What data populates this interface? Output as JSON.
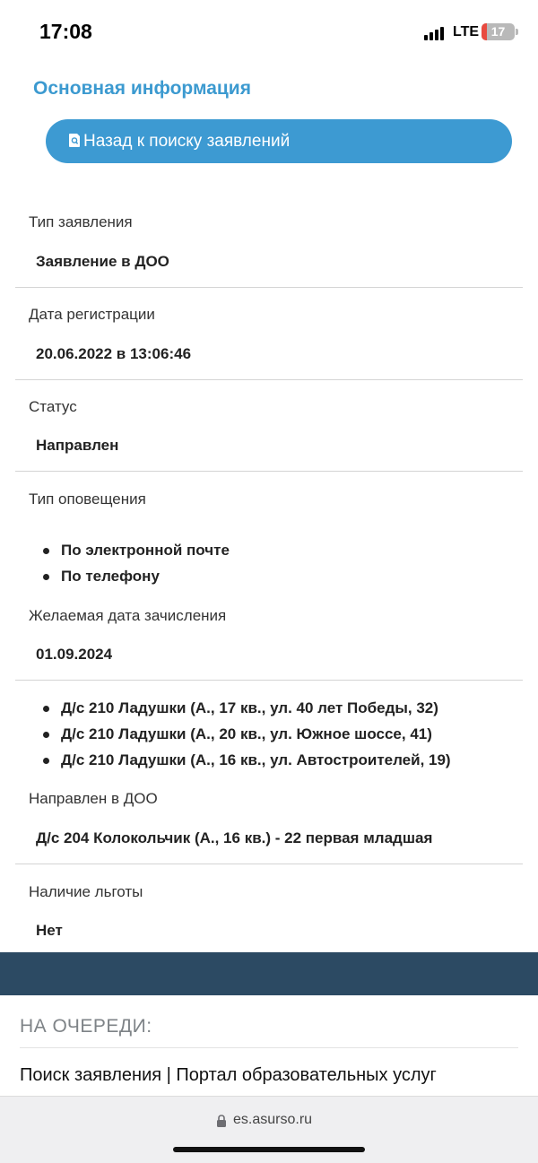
{
  "status_bar": {
    "time": "17:08",
    "network": "LTE",
    "battery": "17",
    "battery_level": 0.17
  },
  "header": {
    "title": "Основная информация",
    "back_button": "Назад к поиску заявлений",
    "back_icon": "search-document-icon"
  },
  "fields": {
    "type": {
      "label": "Тип заявления",
      "value": "Заявление в ДОО"
    },
    "registration": {
      "label": "Дата регистрации",
      "value": "20.06.2022 в 13:06:46"
    },
    "status": {
      "label": "Статус",
      "value": "Направлен"
    },
    "notification": {
      "label": "Тип оповещения",
      "items": [
        "По электронной почте",
        "По телефону"
      ]
    },
    "desired_date": {
      "label": "Желаемая дата зачисления",
      "value": "01.09.2024"
    },
    "preferred_doo": [
      "Д/с 210 Ладушки (А., 17 кв., ул. 40 лет Победы, 32)",
      "Д/с 210 Ладушки (А., 20 кв., ул. Южное шоссе, 41)",
      "Д/с 210 Ладушки (А., 16 кв., ул. Автостроителей, 19)"
    ],
    "assigned": {
      "label": "Направлен в ДОО",
      "value": "Д/с 204 Колокольчик (А., 16 кв.) - 22 первая младшая"
    },
    "benefit": {
      "label": "Наличие льготы",
      "value": "Нет"
    }
  },
  "footer": {
    "queue_heading": "НА ОЧЕРЕДИ:",
    "page_title": "Поиск заявления | Портал образовательных услуг"
  },
  "browser": {
    "url": "es.asurso.ru"
  },
  "colors": {
    "accent": "#3d9ad2",
    "title": "#3c9ad0",
    "band": "#2c4a63"
  }
}
